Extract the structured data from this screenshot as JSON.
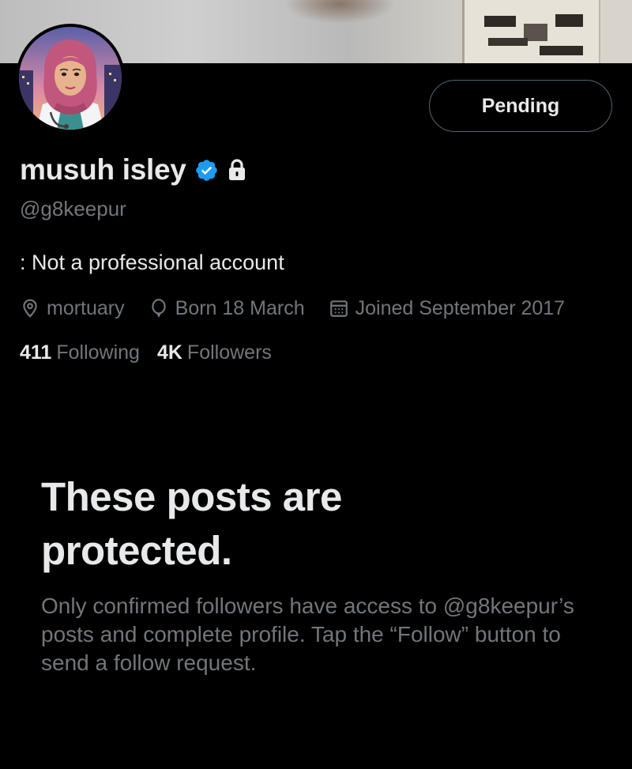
{
  "profile": {
    "display_name": "musuh isley",
    "handle": "@g8keepur",
    "bio": ": Not a professional account",
    "location": "mortuary",
    "birthday": "Born 18 March",
    "joined": "Joined September 2017",
    "following_count": "411",
    "following_label": "Following",
    "followers_count": "4K",
    "followers_label": "Followers"
  },
  "actions": {
    "pending_label": "Pending"
  },
  "protected": {
    "title": "These posts are protected.",
    "description": "Only confirmed followers have access to @g8keepur’s posts and complete profile. Tap the “Follow” button to send a follow request."
  },
  "icons": {
    "verified": "verified-badge-icon",
    "lock": "lock-icon",
    "location": "location-pin-icon",
    "birthday": "balloon-icon",
    "joined": "calendar-icon"
  },
  "colors": {
    "background": "#000000",
    "text_primary": "#e7e9ea",
    "text_secondary": "#71767b",
    "verified_blue": "#1d9bf0",
    "button_border": "#536471"
  }
}
